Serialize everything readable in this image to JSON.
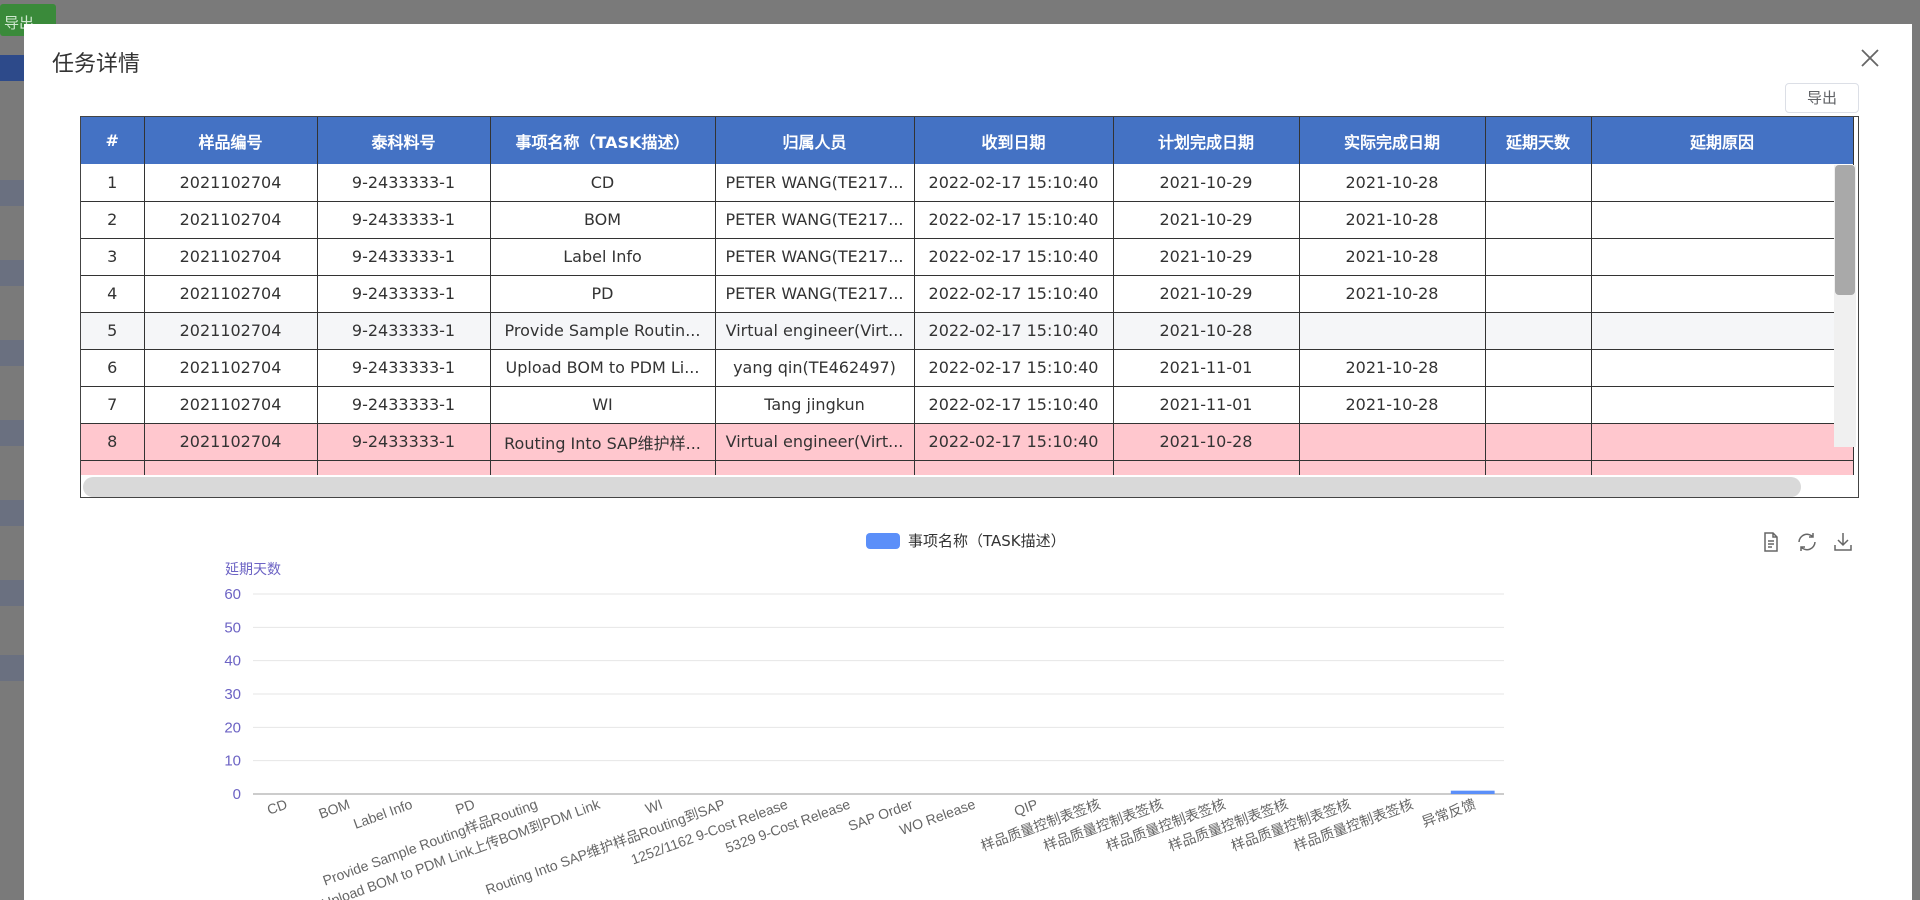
{
  "background": {
    "export_label": "导出"
  },
  "modal": {
    "title": "任务详情",
    "export_label": "导出"
  },
  "table": {
    "columns": [
      "#",
      "样品编号",
      "泰科料号",
      "事项名称（TASK描述）",
      "归属人员",
      "收到日期",
      "计划完成日期",
      "实际完成日期",
      "延期天数",
      "延期原因"
    ],
    "rows": [
      {
        "style": "",
        "cells": [
          "1",
          "2021102704",
          "9-2433333-1",
          "CD",
          "PETER WANG(TE217...",
          "2022-02-17 15:10:40",
          "2021-10-29",
          "2021-10-28",
          "",
          ""
        ]
      },
      {
        "style": "",
        "cells": [
          "2",
          "2021102704",
          "9-2433333-1",
          "BOM",
          "PETER WANG(TE217...",
          "2022-02-17 15:10:40",
          "2021-10-29",
          "2021-10-28",
          "",
          ""
        ]
      },
      {
        "style": "",
        "cells": [
          "3",
          "2021102704",
          "9-2433333-1",
          "Label Info",
          "PETER WANG(TE217...",
          "2022-02-17 15:10:40",
          "2021-10-29",
          "2021-10-28",
          "",
          ""
        ]
      },
      {
        "style": "",
        "cells": [
          "4",
          "2021102704",
          "9-2433333-1",
          "PD",
          "PETER WANG(TE217...",
          "2022-02-17 15:10:40",
          "2021-10-29",
          "2021-10-28",
          "",
          ""
        ]
      },
      {
        "style": "gray",
        "cells": [
          "5",
          "2021102704",
          "9-2433333-1",
          "Provide Sample Routin...",
          "Virtual engineer(Virt...",
          "2022-02-17 15:10:40",
          "2021-10-28",
          "",
          "",
          ""
        ]
      },
      {
        "style": "",
        "cells": [
          "6",
          "2021102704",
          "9-2433333-1",
          "Upload BOM to PDM Li...",
          "yang qin(TE462497)",
          "2022-02-17 15:10:40",
          "2021-11-01",
          "2021-10-28",
          "",
          ""
        ]
      },
      {
        "style": "",
        "cells": [
          "7",
          "2021102704",
          "9-2433333-1",
          "WI",
          "Tang jingkun",
          "2022-02-17 15:10:40",
          "2021-11-01",
          "2021-10-28",
          "",
          ""
        ]
      },
      {
        "style": "pink",
        "cells": [
          "8",
          "2021102704",
          "9-2433333-1",
          "Routing Into SAP维护样...",
          "Virtual engineer(Virt...",
          "2022-02-17 15:10:40",
          "2021-10-28",
          "",
          "",
          ""
        ]
      },
      {
        "style": "pink",
        "cells": [
          "",
          "",
          "",
          "",
          "",
          "",
          "",
          "",
          "",
          ""
        ]
      }
    ]
  },
  "chart": {
    "legend_label": "事项名称（TASK描述）",
    "series_color": "#5b8ff9",
    "toolbox_icons": [
      "data-view-icon",
      "refresh-icon",
      "download-icon"
    ]
  },
  "chart_data": {
    "type": "bar",
    "title": "",
    "xlabel": "",
    "ylabel": "延期天数",
    "ylim": [
      0,
      60
    ],
    "yticks": [
      0,
      10,
      20,
      30,
      40,
      50,
      60
    ],
    "grid": true,
    "legend_position": "top-center",
    "categories": [
      "CD",
      "BOM",
      "Label Info",
      "PD",
      "Provide Sample Routing样品Routing",
      "Upload BOM to PDM Link上传BOM到PDM Link",
      "WI",
      "Routing Into SAP维护样品Routing到SAP",
      "1252/1162 9-Cost Release",
      "5329 9-Cost Release",
      "SAP Order",
      "WO Release",
      "QIP",
      "样品质量控制表签核",
      "样品质量控制表签核",
      "样品质量控制表签核",
      "样品质量控制表签核",
      "样品质量控制表签核",
      "样品质量控制表签核",
      "异常反馈"
    ],
    "series": [
      {
        "name": "事项名称（TASK描述）",
        "values": [
          0,
          0,
          0,
          0,
          0,
          0,
          0,
          0,
          0,
          0,
          0,
          0,
          0,
          0,
          0,
          0,
          0,
          0,
          0,
          1
        ]
      }
    ]
  }
}
